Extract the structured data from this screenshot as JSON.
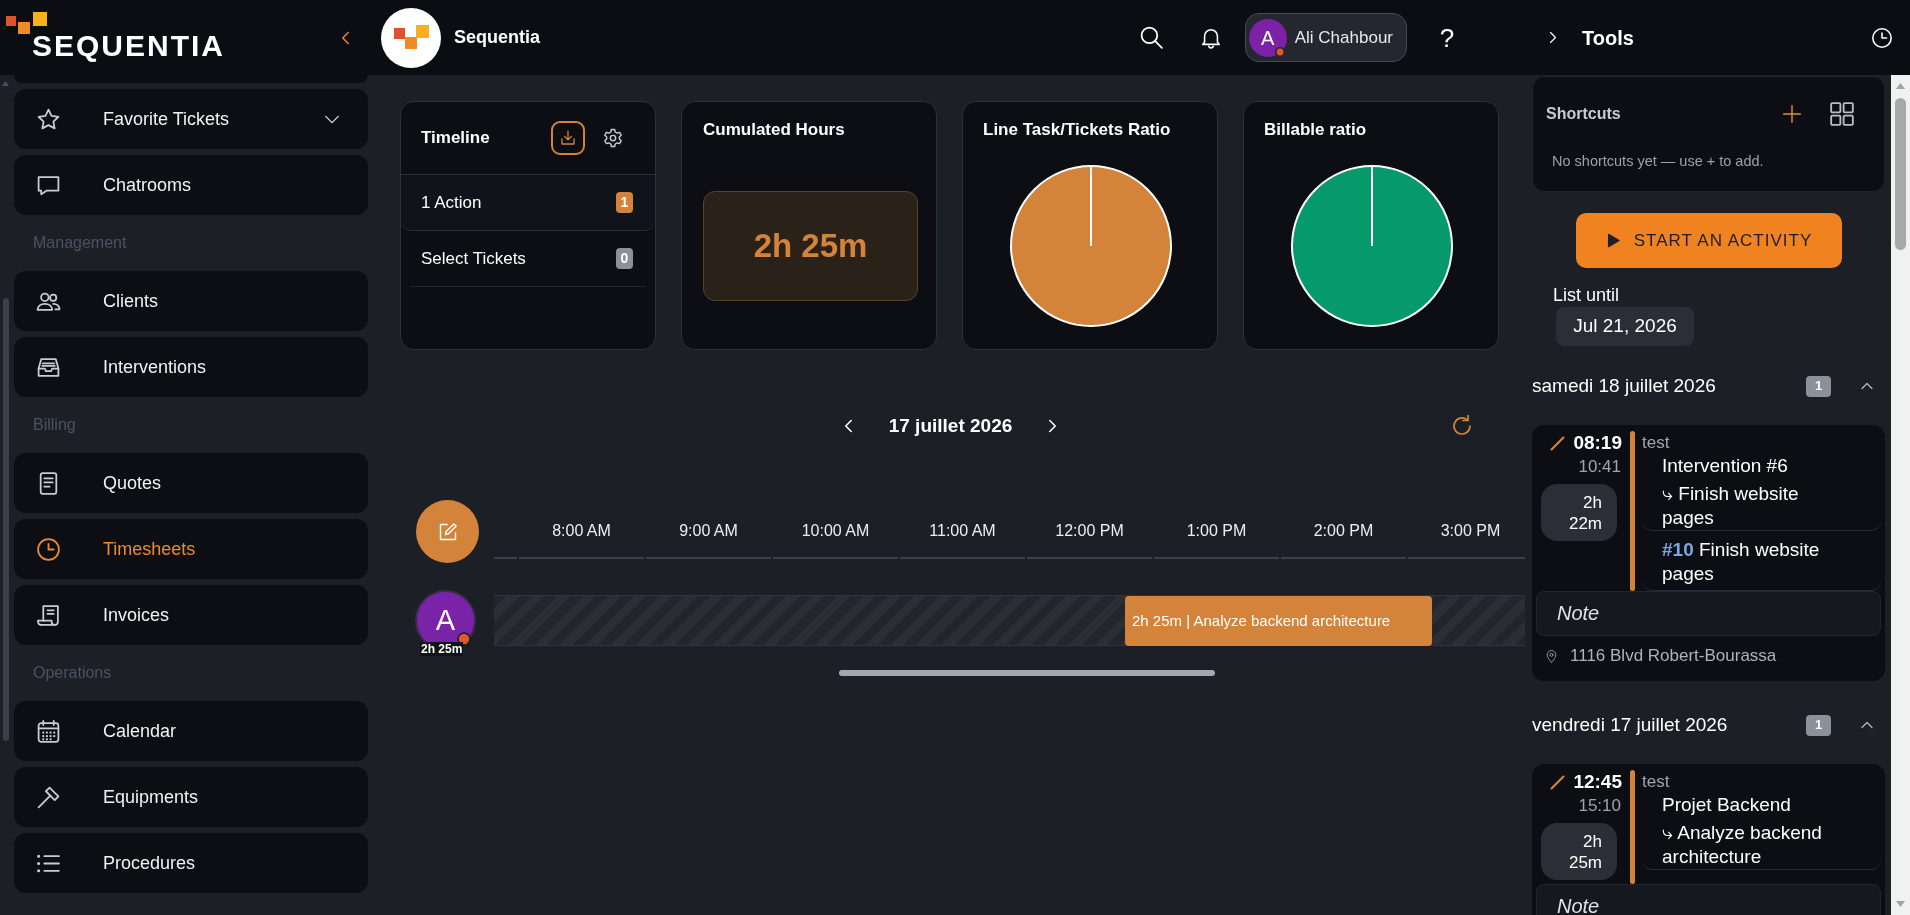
{
  "header": {
    "brand": "SEQUENTIA",
    "workspace": "Sequentia",
    "user": {
      "initial": "A",
      "name": "Ali Chahbour"
    },
    "help": "?"
  },
  "sidebar": {
    "sections": [
      {
        "items": [
          {
            "label": "Favorite Tickets",
            "kind": "group",
            "selected": false
          },
          {
            "label": "Chatrooms",
            "kind": "link",
            "selected": false
          }
        ]
      },
      {
        "title": "Management",
        "items": [
          {
            "label": "Clients",
            "kind": "link",
            "selected": false
          },
          {
            "label": "Interventions",
            "kind": "link",
            "selected": false
          }
        ]
      },
      {
        "title": "Billing",
        "items": [
          {
            "label": "Quotes",
            "kind": "link",
            "selected": false
          },
          {
            "label": "Timesheets",
            "kind": "link",
            "selected": true
          },
          {
            "label": "Invoices",
            "kind": "link",
            "selected": false
          }
        ]
      },
      {
        "title": "Operations",
        "items": [
          {
            "label": "Calendar",
            "kind": "link",
            "selected": false
          },
          {
            "label": "Equipments",
            "kind": "link",
            "selected": false
          },
          {
            "label": "Procedures",
            "kind": "link",
            "selected": false
          }
        ]
      }
    ]
  },
  "cards": [
    {
      "kind": "list",
      "title": "Timeline",
      "rows": [
        {
          "label": "1 Action",
          "count": "1",
          "selected": true
        },
        {
          "label": "Select Tickets",
          "count": "0",
          "selected": false
        }
      ]
    },
    {
      "kind": "value",
      "title": "Cumulated Hours",
      "value": "2h 25m"
    },
    {
      "kind": "pie",
      "title": "Line Task/Tickets Ratio",
      "color": "#d3843a"
    },
    {
      "kind": "pie",
      "title": "Billable ratio",
      "color": "#069a6b"
    }
  ],
  "timeline": {
    "date": "17 juillet 2026",
    "hours": [
      "8:00 AM",
      "9:00 AM",
      "10:00 AM",
      "11:00 AM",
      "12:00 PM",
      "1:00 PM",
      "2:00 PM",
      "3:00 PM"
    ],
    "rows": [
      {
        "initial": "A",
        "total": "2h 25m",
        "events": [
          {
            "label": "2h 25m | Analyze backend architecture"
          }
        ]
      }
    ]
  },
  "tools": {
    "title": "Tools",
    "shortcuts": {
      "title": "Shortcuts",
      "empty_text": "No shortcuts yet — use + to add."
    },
    "start_button": "START AN ACTIVITY",
    "list_until": {
      "label": "List until",
      "value": "Jul 21, 2026"
    },
    "days": [
      {
        "label": "samedi 18 juillet 2026",
        "count": "1",
        "expanded": true,
        "entries": [
          {
            "start": "08:19",
            "end": "10:41",
            "duration": "2h 22m",
            "category": "test",
            "lines": [
              {
                "kind": "task",
                "project": "Intervention #6",
                "task": "⤷ Finish website pages"
              },
              {
                "kind": "ticket",
                "number": "#10",
                "title": "Finish website pages"
              }
            ],
            "note": {
              "placeholder": "Note"
            },
            "location": "1116 Blvd Robert-Bourassa"
          }
        ]
      },
      {
        "label": "vendredi 17 juillet 2026",
        "count": "1",
        "expanded": true,
        "entries": [
          {
            "start": "12:45",
            "end": "15:10",
            "duration": "2h 25m",
            "category": "test",
            "lines": [
              {
                "kind": "task",
                "project": "Projet Backend",
                "task": "⤷ Analyze backend architecture"
              }
            ],
            "note": {
              "placeholder": "Note"
            }
          }
        ]
      }
    ]
  }
}
